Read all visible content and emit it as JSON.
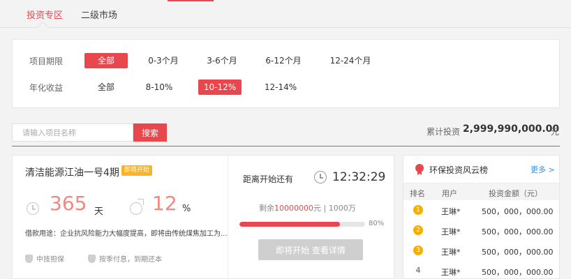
{
  "tabs": [
    {
      "label": "投资专区",
      "active": true
    },
    {
      "label": "二级市场",
      "active": false
    }
  ],
  "filters": {
    "term": {
      "label": "项目期限",
      "options": [
        "全部",
        "0-3个月",
        "3-6个月",
        "6-12个月",
        "12-24个月"
      ],
      "selected": "全部"
    },
    "yield": {
      "label": "年化收益",
      "options": [
        "全部",
        "8-10%",
        "10-12%",
        "12-14%"
      ],
      "selected": "10-12%"
    }
  },
  "search": {
    "placeholder": "请输入项目名称",
    "button": "搜索"
  },
  "total": {
    "label": "累计投资",
    "amount": "2,999,990,000.00",
    "unit": "元"
  },
  "project": {
    "title": "清洁能源江油一号4期",
    "badge": "即将开始",
    "days": "365",
    "days_unit": "天",
    "rate": "12",
    "rate_unit": "%",
    "purpose": "借款用途：企业抗风险能力大幅度提高，即将由传统煤焦加工为...",
    "feature_1": "中技担保",
    "feature_2": "按季付息，到期还本",
    "countdown_label": "距离开始还有",
    "countdown": "12:32:29",
    "remain_prefix": "剩余",
    "remain_amount": "10000000",
    "remain_suffix": "元 | 1000万",
    "progress_fraction": 0.8,
    "progress_pct": "80%",
    "button": "即将开始  查看详情"
  },
  "colors": {
    "accent": "#e8474d",
    "badge": "#f7b32b",
    "link": "#3a8ee6",
    "big_number": "#f4877f"
  },
  "ranking": {
    "title": "环保投资风云榜",
    "more": "更多 >",
    "headers": [
      "排名",
      "用户",
      "投资金额（元）"
    ],
    "rows": [
      {
        "rank": "1",
        "user": "王琳*",
        "amount": "500，000，000.00"
      },
      {
        "rank": "2",
        "user": "王琳*",
        "amount": "500，000，000.00"
      },
      {
        "rank": "3",
        "user": "王琳*",
        "amount": "500，000，000.00"
      },
      {
        "rank": "4",
        "user": "王琳*",
        "amount": "500，000，000.00"
      }
    ]
  }
}
